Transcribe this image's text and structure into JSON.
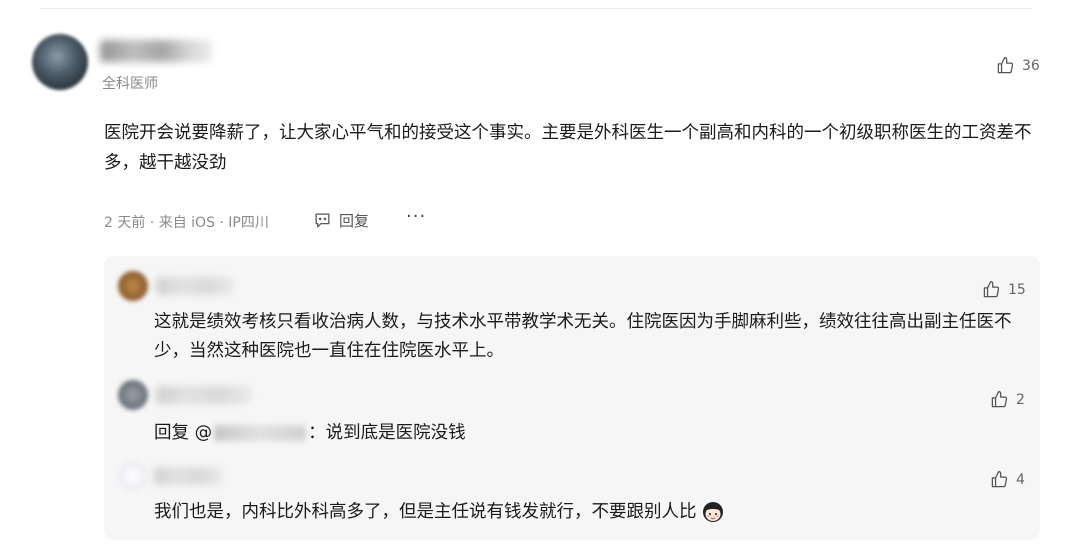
{
  "comment": {
    "author_role": "全科医师",
    "likes": "36",
    "text": "医院开会说要降薪了，让大家心平气和的接受这个事实。主要是外科医生一个副高和内科的一个初级职称医生的工资差不多，越干越没劲",
    "meta": "2 天前 · 来自 iOS · IP四川",
    "reply_label": "回复",
    "more_label": "···"
  },
  "replies": [
    {
      "likes": "15",
      "text": "这就是绩效考核只看收治病人数，与技术水平带教学术无关。住院医因为手脚麻利些，绩效往往高出副主任医不少，当然这种医院也一直住在住院医水平上。"
    },
    {
      "likes": "2",
      "prefix": "回复 @",
      "text": "：说到底是医院没钱"
    },
    {
      "likes": "4",
      "text": "我们也是，内科比外科高多了，但是主任说有钱发就行，不要跟别人比"
    }
  ],
  "icons": {
    "like": "thumbs-up-icon",
    "reply": "comment-bubble-icon",
    "more": "more-dots-icon"
  },
  "colors": {
    "reply_box_bg": "#f6f6f6",
    "meta_gray": "#8a8a8a"
  }
}
